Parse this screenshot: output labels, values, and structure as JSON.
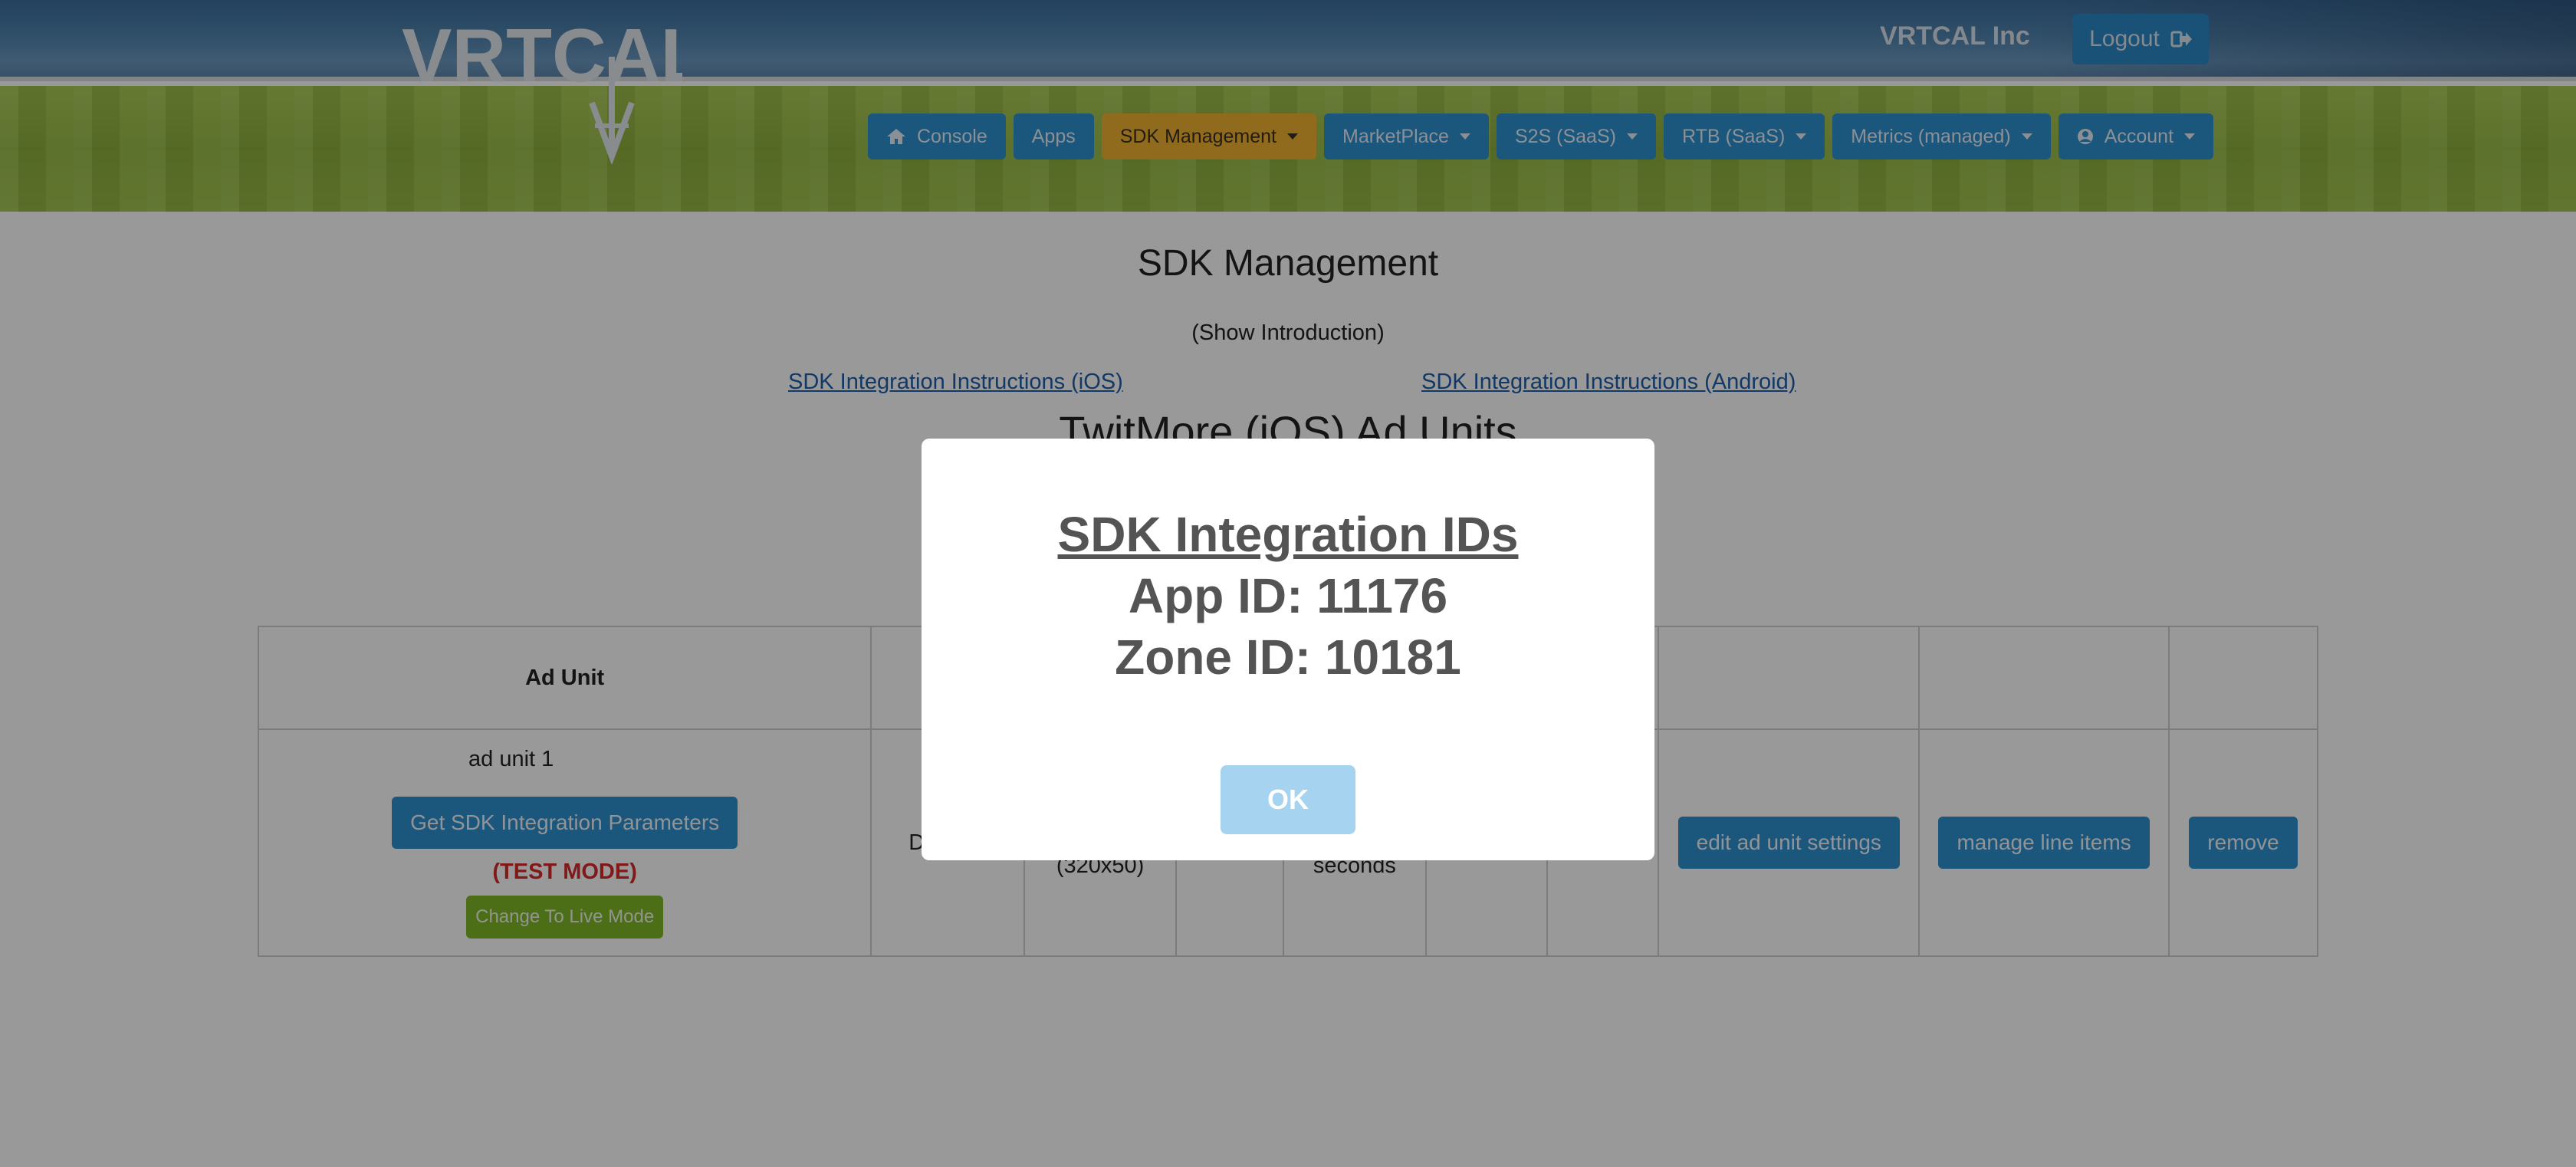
{
  "brand": {
    "logo_text": "VRTCAL",
    "company": "VRTCAL Inc"
  },
  "header": {
    "logout_label": "Logout"
  },
  "nav": {
    "console": "Console",
    "apps": "Apps",
    "sdk_management": "SDK Management",
    "marketplace": "MarketPlace",
    "s2s": "S2S (SaaS)",
    "rtb": "RTB (SaaS)",
    "metrics": "Metrics (managed)",
    "account": "Account"
  },
  "page": {
    "title": "SDK Management",
    "show_intro": "(Show Introduction)",
    "ios_link": "SDK Integration Instructions (iOS)",
    "android_link": "SDK Integration Instructions (Android)",
    "section_title": "TwitMore (iOS) Ad Units"
  },
  "table": {
    "header_ad_unit": "Ad Unit",
    "row": {
      "name": "ad unit 1",
      "get_params": "Get SDK Integration Parameters",
      "mode": "(TEST MODE)",
      "change_mode": "Change To Live Mode",
      "type_partial": "D",
      "size": "(320x50)",
      "refresh": "seconds",
      "edit": "edit ad unit settings",
      "manage": "manage line items",
      "remove": "remove"
    }
  },
  "modal": {
    "title": "SDK Integration IDs",
    "app_id": "App ID: 11176",
    "zone_id": "Zone ID: 10181",
    "ok": "OK"
  },
  "colors": {
    "header_blue": "#4f82ad",
    "nav_green": "#9fc24a",
    "button_blue": "#2e8fd0",
    "active_nav": "#f2b231",
    "test_mode_red": "#d92b2b",
    "ok_button": "#a5d3f0"
  }
}
